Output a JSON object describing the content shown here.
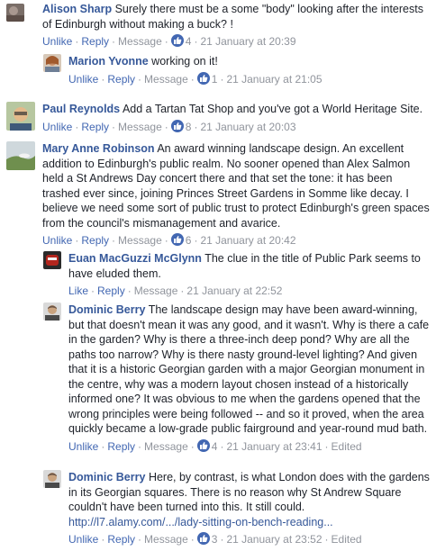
{
  "comments": [
    {
      "author": "Alison Sharp",
      "text": "Surely there must be a some \"body\" looking after the interests of Edinburgh without making a buck? !",
      "actions": {
        "like": "Unlike",
        "reply": "Reply",
        "message": "Message"
      },
      "likes": "4",
      "time": "21 January at 20:39"
    },
    {
      "author": "Marion Yvonne",
      "text": "working on it!",
      "actions": {
        "like": "Unlike",
        "reply": "Reply",
        "message": "Message"
      },
      "likes": "1",
      "time": "21 January at 21:05"
    },
    {
      "author": "Paul Reynolds",
      "text": "Add a Tartan Tat Shop and you've got a World Heritage Site.",
      "actions": {
        "like": "Unlike",
        "reply": "Reply",
        "message": "Message"
      },
      "likes": "8",
      "time": "21 January at 20:03"
    },
    {
      "author": "Mary Anne Robinson",
      "text": "An award winning landscape design. An excellent addition to Edinburgh's public realm. No sooner opened than Alex Salmon held a St Andrews Day concert there and that set the tone: it has been trashed ever since, joining Princes Street Gardens in Somme like decay. I believe we need some sort of public trust to protect Edinburgh's green spaces from the council's mismanagement and avarice.",
      "actions": {
        "like": "Unlike",
        "reply": "Reply",
        "message": "Message"
      },
      "likes": "6",
      "time": "21 January at 20:42"
    },
    {
      "author": "Euan MacGuzzi McGlynn",
      "text": "The clue in the title of Public Park seems to have eluded them.",
      "actions": {
        "like": "Like",
        "reply": "Reply",
        "message": "Message"
      },
      "time": "21 January at 22:52"
    },
    {
      "author": "Dominic Berry",
      "text": "The landscape design may have been award-winning, but that doesn't mean it was any good, and it wasn't. Why is there a cafe in the garden? Why is there a three-inch deep pond? Why are all the paths too narrow? Why is there nasty ground-level lighting? And given that it is a historic Georgian garden with a major Georgian monument in the centre, why was a modern layout chosen instead of a historically informed one? It was obvious to me when the gardens opened that the wrong principles were being followed -- and so it proved, when the area quickly became a low-grade public fairground and year-round mud bath.",
      "actions": {
        "like": "Unlike",
        "reply": "Reply",
        "message": "Message"
      },
      "likes": "4",
      "time": "21 January at 23:41",
      "edited": "Edited"
    },
    {
      "author": "Dominic Berry",
      "text": "Here, by contrast, is what London does with the gardens in its Georgian squares. There is no reason why St Andrew Square couldn't have been turned into this. It still could.",
      "link": "http://l7.alamy.com/.../lady-sitting-on-bench-reading...",
      "actions": {
        "like": "Unlike",
        "reply": "Reply",
        "message": "Message"
      },
      "likes": "3",
      "time": "21 January at 23:52",
      "edited": "Edited"
    }
  ],
  "colors": {
    "author": "#365899",
    "action": "#4267b2",
    "meta": "#90949c",
    "like_badge": "#4267b2"
  },
  "icons": {
    "like_badge": "thumbs-up-icon"
  }
}
